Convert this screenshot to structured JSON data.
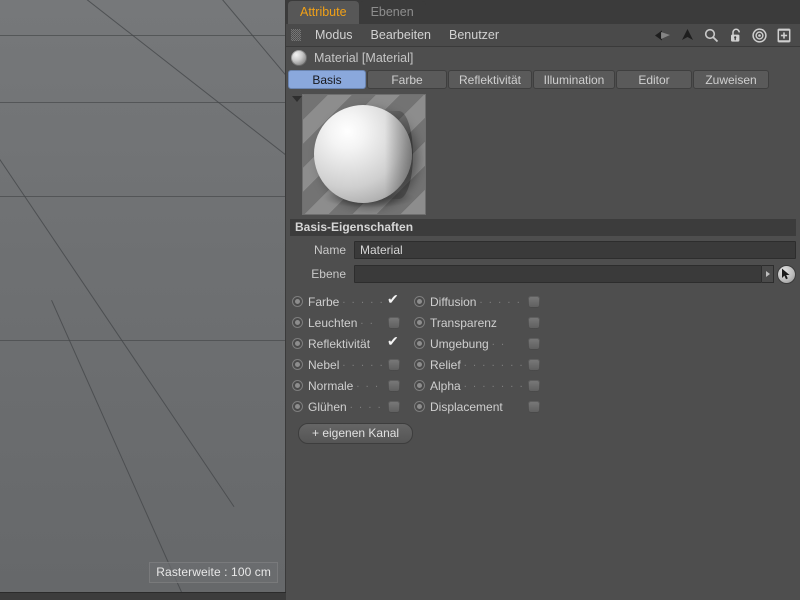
{
  "viewport": {
    "grid_label": "Rasterweite : 100 cm"
  },
  "panel": {
    "window_tabs": [
      {
        "label": "Attribute",
        "active": true
      },
      {
        "label": "Ebenen",
        "active": false
      }
    ],
    "menus": [
      "Modus",
      "Bearbeiten",
      "Benutzer"
    ],
    "toolbar_icons": [
      "back-arrow-icon",
      "up-arrow-icon",
      "search-icon",
      "unlock-icon",
      "target-icon",
      "add-box-icon"
    ],
    "object_title": "Material [Material]",
    "material_tabs": [
      {
        "label": "Basis",
        "active": true
      },
      {
        "label": "Farbe",
        "active": false
      },
      {
        "label": "Reflektivität",
        "active": false
      },
      {
        "label": "Illumination",
        "active": false
      },
      {
        "label": "Editor",
        "active": false
      },
      {
        "label": "Zuweisen",
        "active": false
      }
    ],
    "section_title": "Basis-Eigenschaften",
    "fields": {
      "name_label": "Name",
      "name_value": "Material",
      "name_placeholder": "",
      "ebene_label": "Ebene",
      "ebene_value": "",
      "ebene_placeholder": ""
    },
    "channels": [
      {
        "label": "Farbe",
        "dots": ". . . . .",
        "checked": true
      },
      {
        "label": "Diffusion",
        "dots": ". . . . . .",
        "checked": false
      },
      {
        "label": "Leuchten",
        "dots": ". .",
        "checked": false
      },
      {
        "label": "Transparenz",
        "dots": "",
        "checked": false
      },
      {
        "label": "Reflektivität",
        "dots": "",
        "checked": true
      },
      {
        "label": "Umgebung",
        "dots": ". .",
        "checked": false
      },
      {
        "label": "Nebel",
        "dots": ". . . . .",
        "checked": false
      },
      {
        "label": "Relief",
        "dots": ". . . . . . .",
        "checked": false
      },
      {
        "label": "Normale",
        "dots": ". . .",
        "checked": false
      },
      {
        "label": "Alpha",
        "dots": ". . . . . . .",
        "checked": false
      },
      {
        "label": "Glühen",
        "dots": ". . . .",
        "checked": false
      },
      {
        "label": "Displacement",
        "dots": "",
        "checked": false
      }
    ],
    "add_channel_label": "+ eigenen Kanal"
  }
}
